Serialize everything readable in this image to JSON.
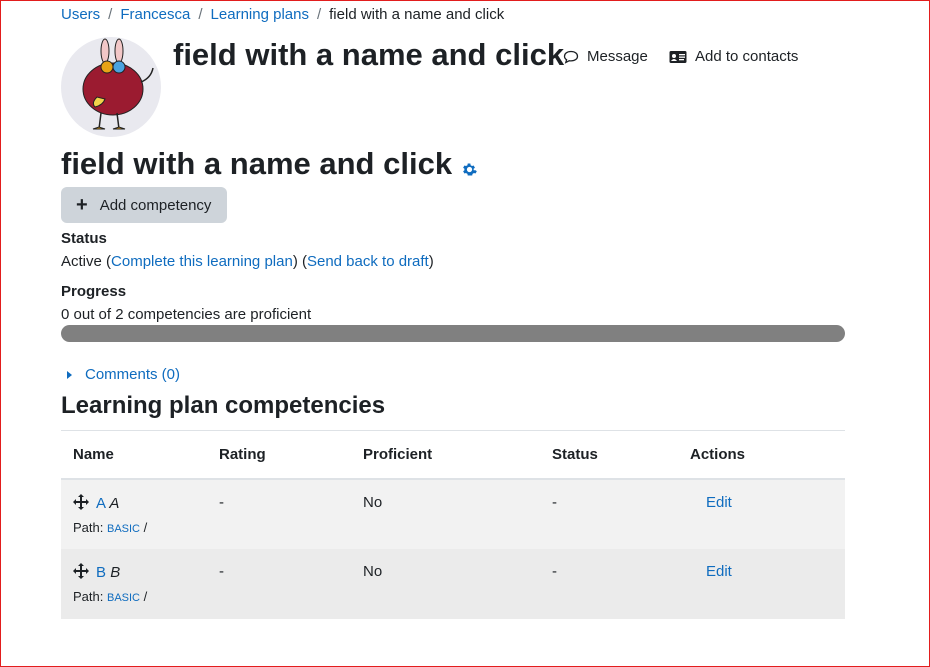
{
  "breadcrumb": {
    "items": [
      "Users",
      "Francesca",
      "Learning plans"
    ],
    "current": "field with a name and click"
  },
  "header": {
    "user_name": "field with a name and click",
    "message_label": "Message",
    "add_contacts_label": "Add to contacts"
  },
  "plan": {
    "title": "field with a name and click",
    "add_competency_label": "Add competency",
    "status_label": "Status",
    "status_value": "Active",
    "complete_link": "Complete this learning plan",
    "draft_link": "Send back to draft",
    "progress_label": "Progress",
    "progress_text": "0 out of 2 competencies are proficient",
    "progress_fraction": 0,
    "comments_link": "Comments (0)"
  },
  "competencies": {
    "title": "Learning plan competencies",
    "headers": [
      "Name",
      "Rating",
      "Proficient",
      "Status",
      "Actions"
    ],
    "rows": [
      {
        "shortname": "A",
        "idnumber": "A",
        "path_label": "Path:",
        "framework": "BASIC",
        "path_sep": "/",
        "rating": "-",
        "proficient": "No",
        "status": "-",
        "action": "Edit"
      },
      {
        "shortname": "B",
        "idnumber": "B",
        "path_label": "Path:",
        "framework": "BASIC",
        "path_sep": "/",
        "rating": "-",
        "proficient": "No",
        "status": "-",
        "action": "Edit"
      }
    ]
  },
  "colors": {
    "link": "#0f6cbf",
    "button_bg": "#ced4da",
    "progress_track": "#e2e4e7",
    "progress_fill": "#808080",
    "frame": "#e21d1d"
  },
  "icons": {
    "message": "speech-bubble-icon",
    "contacts": "address-card-icon",
    "settings": "gear-icon",
    "add": "plus-icon",
    "move": "move-arrows-icon",
    "comments": "caret-right-icon"
  }
}
